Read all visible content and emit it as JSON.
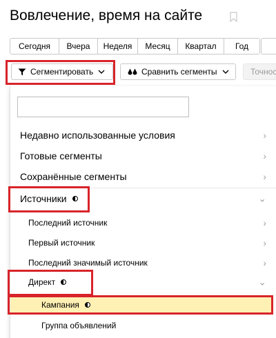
{
  "page": {
    "title": "Вовлечение, время на сайте"
  },
  "period_tabs": [
    "Сегодня",
    "Вчера",
    "Неделя",
    "Месяц",
    "Квартал",
    "Год"
  ],
  "toolbar": {
    "segment_label": "Сегментировать",
    "compare_label": "Сравнить сегменты",
    "accuracy_label": "Точнос"
  },
  "dropdown": {
    "search_value": "",
    "top_items": [
      {
        "label": "Недавно использованные условия"
      },
      {
        "label": "Готовые сегменты"
      },
      {
        "label": "Сохранённые сегменты"
      }
    ],
    "sources": {
      "label": "Источники"
    },
    "source_items": [
      {
        "label": "Последний источник"
      },
      {
        "label": "Первый источник"
      },
      {
        "label": "Последний значимый источник"
      }
    ],
    "direct": {
      "label": "Директ"
    },
    "direct_items": [
      {
        "label": "Кампания"
      },
      {
        "label": "Группа объявлений"
      }
    ]
  },
  "colors": {
    "highlight_border": "#d8232a",
    "selected_row": "#fff0b3"
  }
}
